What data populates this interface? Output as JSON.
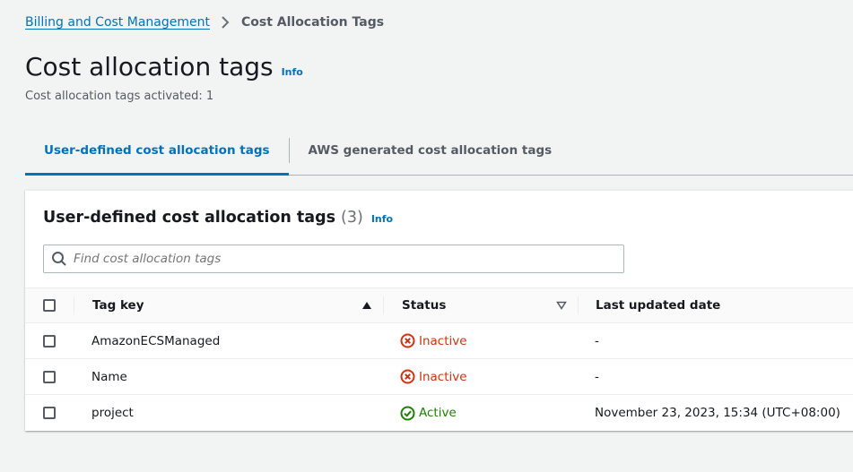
{
  "breadcrumb": {
    "parent": "Billing and Cost Management",
    "current": "Cost Allocation Tags"
  },
  "page": {
    "title": "Cost allocation tags",
    "info": "Info",
    "subtitle": "Cost allocation tags activated: 1"
  },
  "tabs": [
    {
      "label": "User-defined cost allocation tags",
      "active": true
    },
    {
      "label": "AWS generated cost allocation tags",
      "active": false
    }
  ],
  "panel": {
    "title": "User-defined cost allocation tags",
    "count": "(3)",
    "info": "Info"
  },
  "search": {
    "placeholder": "Find cost allocation tags"
  },
  "table": {
    "columns": {
      "tag_key": "Tag key",
      "status": "Status",
      "last_updated": "Last updated date"
    },
    "rows": [
      {
        "tag_key": "AmazonECSManaged",
        "status": "Inactive",
        "last_updated": "-"
      },
      {
        "tag_key": "Name",
        "status": "Inactive",
        "last_updated": "-"
      },
      {
        "tag_key": "project",
        "status": "Active",
        "last_updated": "November 23, 2023, 15:34 (UTC+08:00)"
      }
    ]
  },
  "colors": {
    "link": "#0073bb",
    "inactive": "#d13212",
    "active": "#1d8102"
  }
}
